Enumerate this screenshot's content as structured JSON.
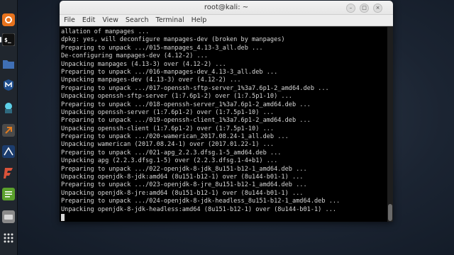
{
  "window": {
    "title": "root@kali: ~",
    "menu": [
      "File",
      "Edit",
      "View",
      "Search",
      "Terminal",
      "Help"
    ]
  },
  "dock": {
    "items": [
      {
        "name": "firefox-icon",
        "color": "#e8731d"
      },
      {
        "name": "terminal-icon",
        "color": "#2a2a2a"
      },
      {
        "name": "files-icon",
        "color": "#3f6fb5"
      },
      {
        "name": "metasploit-icon",
        "color": "#1f4f8f"
      },
      {
        "name": "armitage-icon",
        "color": "#3a6e8a"
      },
      {
        "name": "burpsuite-icon",
        "color": "#e27c1e"
      },
      {
        "name": "maltego-icon",
        "color": "#2b5fa8"
      },
      {
        "name": "faraday-icon",
        "color": "#d9533a"
      },
      {
        "name": "leafpad-icon",
        "color": "#5aa02c"
      },
      {
        "name": "cherrytree-icon",
        "color": "#8a8a8a"
      },
      {
        "name": "app-grid-icon",
        "color": "#2b2f36"
      }
    ]
  },
  "terminal": {
    "lines": [
      "allation of manpages ...",
      "dpkg: yes, will deconfigure manpages-dev (broken by manpages)",
      "Preparing to unpack .../015-manpages_4.13-3_all.deb ...",
      "De-configuring manpages-dev (4.12-2) ...",
      "Unpacking manpages (4.13-3) over (4.12-2) ...",
      "Preparing to unpack .../016-manpages-dev_4.13-3_all.deb ...",
      "Unpacking manpages-dev (4.13-3) over (4.12-2) ...",
      "Preparing to unpack .../017-openssh-sftp-server_1%3a7.6p1-2_amd64.deb ...",
      "Unpacking openssh-sftp-server (1:7.6p1-2) over (1:7.5p1-10) ...",
      "Preparing to unpack .../018-openssh-server_1%3a7.6p1-2_amd64.deb ...",
      "Unpacking openssh-server (1:7.6p1-2) over (1:7.5p1-10) ...",
      "Preparing to unpack .../019-openssh-client_1%3a7.6p1-2_amd64.deb ...",
      "Unpacking openssh-client (1:7.6p1-2) over (1:7.5p1-10) ...",
      "Preparing to unpack .../020-wamerican_2017.08.24-1_all.deb ...",
      "Unpacking wamerican (2017.08.24-1) over (2017.01.22-1) ...",
      "Preparing to unpack .../021-apg_2.2.3.dfsg.1-5_amd64.deb ...",
      "Unpacking apg (2.2.3.dfsg.1-5) over (2.2.3.dfsg.1-4+b1) ...",
      "Preparing to unpack .../022-openjdk-8-jdk_8u151-b12-1_amd64.deb ...",
      "Unpacking openjdk-8-jdk:amd64 (8u151-b12-1) over (8u144-b01-1) ...",
      "Preparing to unpack .../023-openjdk-8-jre_8u151-b12-1_amd64.deb ...",
      "Unpacking openjdk-8-jre:amd64 (8u151-b12-1) over (8u144-b01-1) ...",
      "Preparing to unpack .../024-openjdk-8-jdk-headless_8u151-b12-1_amd64.deb ...",
      "Unpacking openjdk-8-jdk-headless:amd64 (8u151-b12-1) over (8u144-b01-1) ..."
    ]
  }
}
